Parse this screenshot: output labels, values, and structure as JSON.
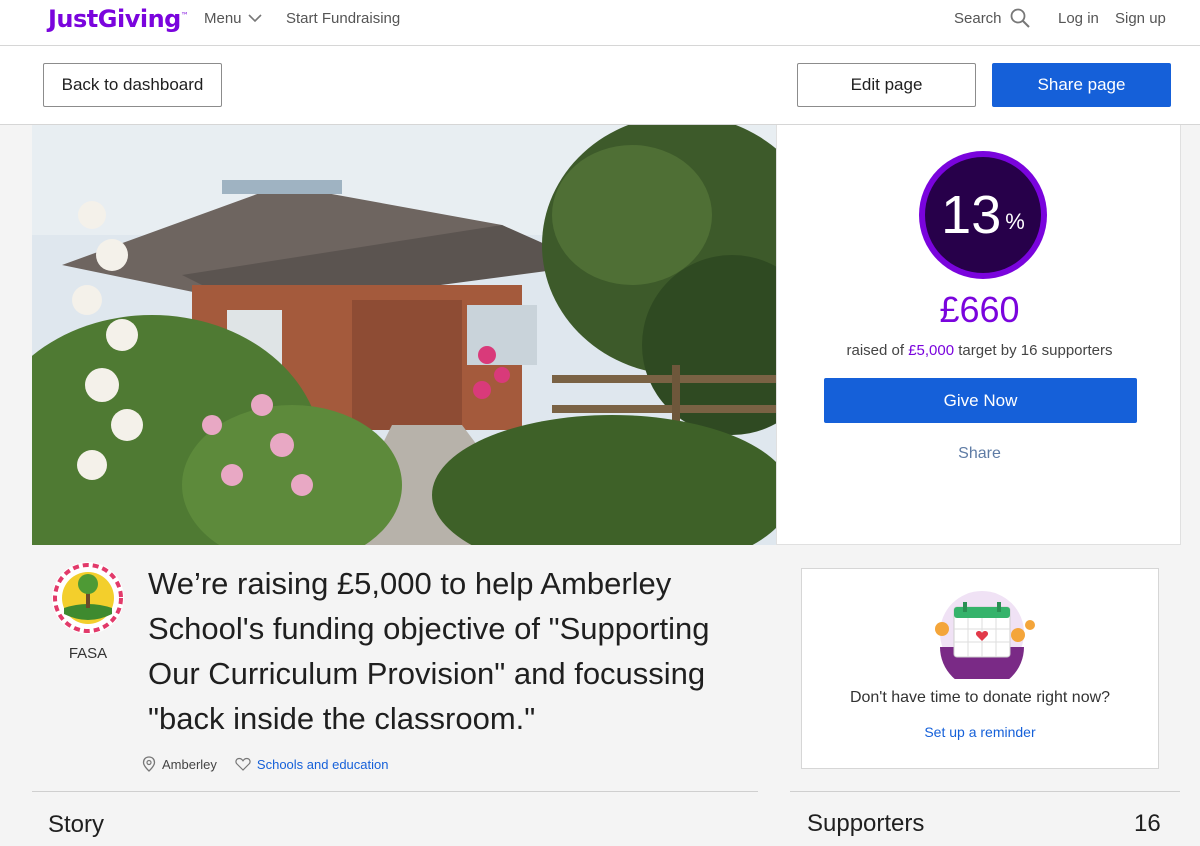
{
  "nav": {
    "logo": "JustGiving",
    "logo_tm": "™",
    "menu": "Menu",
    "start_fundraising": "Start Fundraising",
    "search": "Search",
    "login": "Log in",
    "signup": "Sign up"
  },
  "actions": {
    "back": "Back to dashboard",
    "edit": "Edit page",
    "share": "Share page"
  },
  "progress": {
    "percent": "13",
    "percent_sign": "%",
    "amount": "£660",
    "sub_prefix": "raised of ",
    "target": "£5,000",
    "sub_mid": " target by ",
    "supporters_text": "16 supporters",
    "give_now": "Give Now",
    "share": "Share"
  },
  "charity": {
    "name": "FASA"
  },
  "headline": "We’re raising £5,000 to help Amberley School's funding objective of \"Supporting Our Curriculum Provision\" and focussing \"back inside the classroom.\"",
  "meta": {
    "location": "Amberley",
    "category": "Schools and education"
  },
  "reminder": {
    "text": "Don't have time to donate right now?",
    "link": "Set up a reminder"
  },
  "sections": {
    "story": "Story",
    "supporters": "Supporters",
    "supporters_count": "16"
  },
  "colors": {
    "brand_purple": "#7a04dd",
    "primary_blue": "#1560d9",
    "ring_dark": "#27004a"
  }
}
